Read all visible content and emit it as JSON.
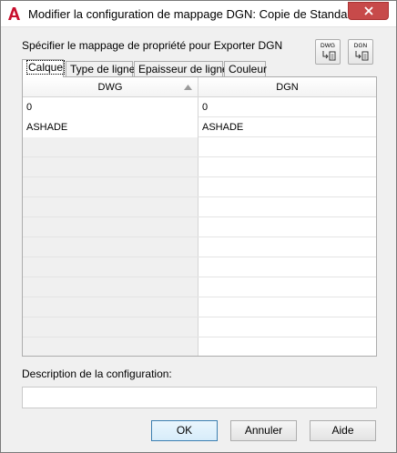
{
  "window": {
    "title": "Modifier la configuration de mappage DGN: Copie de Standard",
    "close_icon": "close-icon",
    "app_icon": "autocad-icon"
  },
  "instruction": "Spécifier le mappage de propriété pour Exporter DGN",
  "map_buttons": [
    {
      "label": "DWG",
      "icon": "map-from-dwg-icon"
    },
    {
      "label": "DGN",
      "icon": "map-from-dgn-icon"
    }
  ],
  "tabs": [
    {
      "label": "Calque",
      "active": true
    },
    {
      "label": "Type de ligne",
      "active": false
    },
    {
      "label": "Epaisseur de ligne",
      "active": false
    },
    {
      "label": "Couleur",
      "active": false
    }
  ],
  "table": {
    "columns": [
      "DWG",
      "DGN"
    ],
    "sorted_column": "DWG",
    "rows": [
      [
        "0",
        "0"
      ],
      [
        "ASHADE",
        "ASHADE"
      ]
    ]
  },
  "description": {
    "label": "Description de la configuration:",
    "value": ""
  },
  "buttons": {
    "ok": "OK",
    "cancel": "Annuler",
    "help": "Aide"
  },
  "colors": {
    "close_button": "#c74a4a",
    "app_icon_red": "#c8102e",
    "default_button_border": "#3c7fb1"
  }
}
